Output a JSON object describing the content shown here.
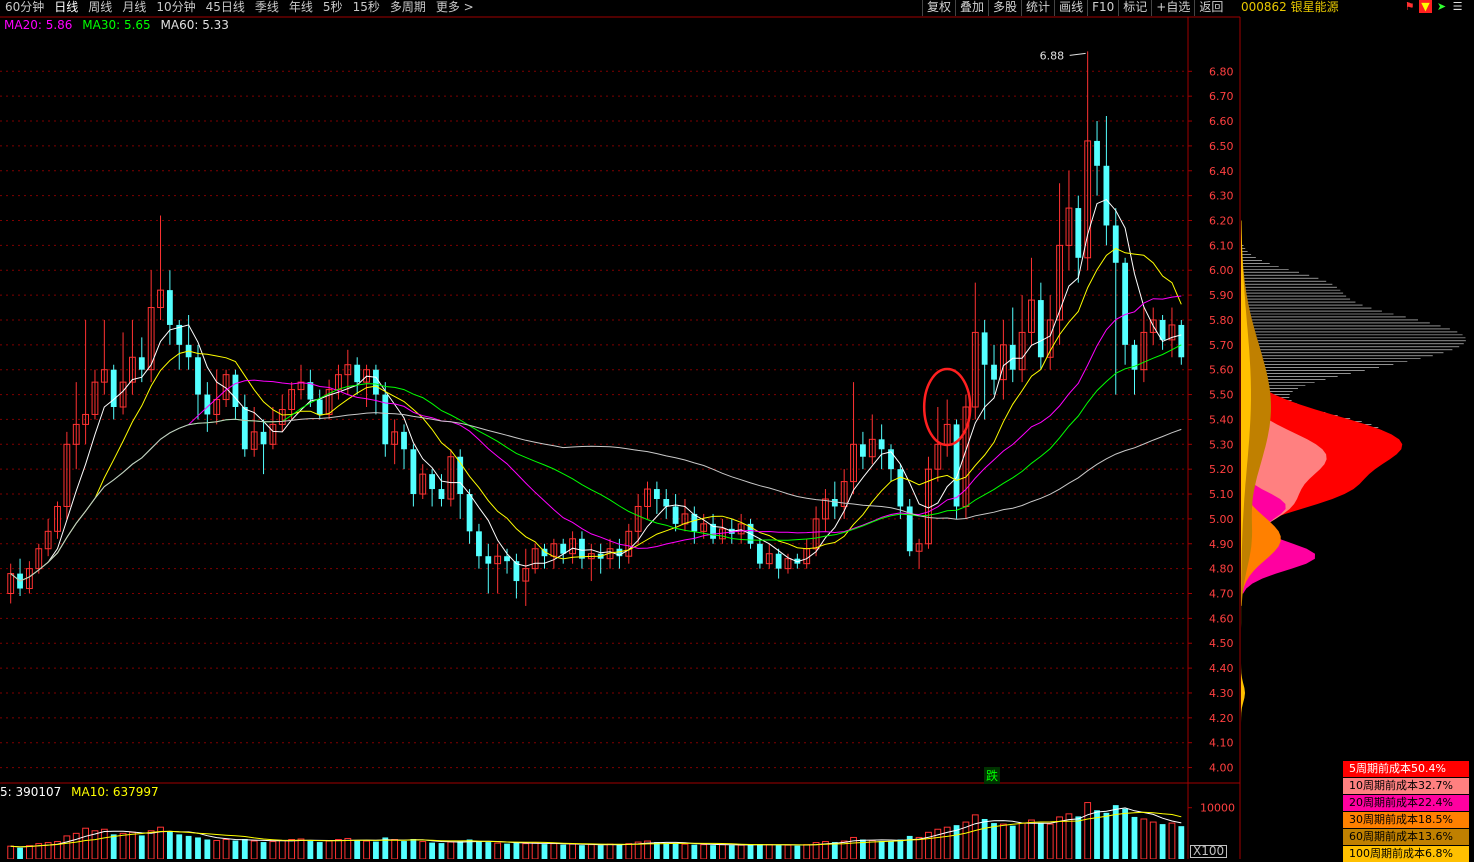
{
  "toolbar": {
    "periods": [
      "60分钟",
      "日线",
      "周线",
      "月线",
      "10分钟",
      "45日线",
      "季线",
      "年线",
      "5秒",
      "15秒",
      "多周期",
      "更多 >"
    ],
    "active_period": "日线",
    "buttons": [
      "复权",
      "叠加",
      "多股",
      "统计",
      "画线",
      "F10",
      "标记",
      "+自选",
      "返回"
    ]
  },
  "stock": {
    "code_name": "000862 银星能源"
  },
  "ma_legend": {
    "ma20": "MA20: 5.86",
    "ma30": "MA30: 5.65",
    "ma60": "MA60: 5.33"
  },
  "vol_legend": {
    "ma5": "5: 390107",
    "ma10": "MA10: 637997"
  },
  "annotations": {
    "high_label": "6.88",
    "die_badge": "跌",
    "vol_unit": "X100"
  },
  "colors": {
    "up": "#ff3232",
    "down": "#54ffff",
    "ma5": "#ffffff",
    "ma10": "#ffff00",
    "ma20": "#ff00ff",
    "ma30": "#00ff00",
    "ma60": "#c8c8c8",
    "grid": "#800000",
    "axis": "#a00000"
  },
  "price_axis": {
    "ticks": [
      "6.80",
      "6.70",
      "6.60",
      "6.50",
      "6.40",
      "6.30",
      "6.20",
      "6.10",
      "6.00",
      "5.90",
      "5.80",
      "5.70",
      "5.60",
      "5.50",
      "5.40",
      "5.30",
      "5.20",
      "5.10",
      "5.00",
      "4.90",
      "4.80",
      "4.70",
      "4.60",
      "4.50",
      "4.40",
      "4.30",
      "4.20",
      "4.10",
      "4.00"
    ]
  },
  "volume_axis": {
    "ticks": [
      "10000"
    ]
  },
  "cost_distribution": [
    {
      "label": "5周期前成本50.4%",
      "bg": "#ff0000",
      "fg": "#ffffff"
    },
    {
      "label": "10周期前成本32.7%",
      "bg": "#ff8080",
      "fg": "#000000"
    },
    {
      "label": "20周期前成本22.4%",
      "bg": "#ff00a0",
      "fg": "#000000"
    },
    {
      "label": "30周期前成本18.5%",
      "bg": "#ff8000",
      "fg": "#000000"
    },
    {
      "label": "60周期前成本13.6%",
      "bg": "#c08000",
      "fg": "#000000"
    },
    {
      "label": "100周期前成本6.8%",
      "bg": "#ffc000",
      "fg": "#000000"
    }
  ],
  "chart_data": {
    "type": "candlestick",
    "ylim": [
      4.0,
      6.88
    ],
    "candles": [
      [
        4.7,
        4.78,
        4.66,
        4.82
      ],
      [
        4.78,
        4.72,
        4.69,
        4.84
      ],
      [
        4.72,
        4.8,
        4.7,
        4.83
      ],
      [
        4.8,
        4.88,
        4.78,
        4.9
      ],
      [
        4.88,
        4.95,
        4.85,
        5.0
      ],
      [
        4.95,
        5.05,
        4.92,
        5.07
      ],
      [
        5.05,
        5.3,
        5.0,
        5.35
      ],
      [
        5.3,
        5.38,
        5.2,
        5.55
      ],
      [
        5.38,
        5.42,
        5.3,
        5.8
      ],
      [
        5.42,
        5.55,
        5.4,
        5.6
      ],
      [
        5.55,
        5.6,
        5.5,
        5.8
      ],
      [
        5.6,
        5.45,
        5.4,
        5.62
      ],
      [
        5.45,
        5.55,
        5.42,
        5.75
      ],
      [
        5.55,
        5.65,
        5.5,
        5.8
      ],
      [
        5.65,
        5.6,
        5.55,
        5.73
      ],
      [
        5.6,
        5.85,
        5.55,
        6.0
      ],
      [
        5.85,
        5.92,
        5.8,
        6.22
      ],
      [
        5.92,
        5.78,
        5.7,
        6.0
      ],
      [
        5.78,
        5.7,
        5.6,
        5.8
      ],
      [
        5.7,
        5.65,
        5.6,
        5.82
      ],
      [
        5.65,
        5.5,
        5.4,
        5.7
      ],
      [
        5.5,
        5.42,
        5.35,
        5.55
      ],
      [
        5.42,
        5.48,
        5.38,
        5.6
      ],
      [
        5.48,
        5.58,
        5.45,
        5.6
      ],
      [
        5.58,
        5.45,
        5.4,
        5.6
      ],
      [
        5.45,
        5.28,
        5.25,
        5.5
      ],
      [
        5.28,
        5.35,
        5.25,
        5.45
      ],
      [
        5.35,
        5.3,
        5.18,
        5.4
      ],
      [
        5.3,
        5.38,
        5.28,
        5.45
      ],
      [
        5.38,
        5.44,
        5.35,
        5.5
      ],
      [
        5.44,
        5.52,
        5.4,
        5.55
      ],
      [
        5.52,
        5.55,
        5.48,
        5.62
      ],
      [
        5.55,
        5.48,
        5.45,
        5.6
      ],
      [
        5.48,
        5.42,
        5.4,
        5.52
      ],
      [
        5.42,
        5.52,
        5.4,
        5.56
      ],
      [
        5.52,
        5.58,
        5.48,
        5.62
      ],
      [
        5.58,
        5.62,
        5.5,
        5.68
      ],
      [
        5.62,
        5.55,
        5.5,
        5.65
      ],
      [
        5.55,
        5.6,
        5.45,
        5.62
      ],
      [
        5.6,
        5.5,
        5.42,
        5.62
      ],
      [
        5.5,
        5.3,
        5.25,
        5.55
      ],
      [
        5.3,
        5.35,
        5.22,
        5.4
      ],
      [
        5.35,
        5.28,
        5.2,
        5.38
      ],
      [
        5.28,
        5.1,
        5.05,
        5.3
      ],
      [
        5.1,
        5.18,
        5.08,
        5.22
      ],
      [
        5.18,
        5.12,
        5.05,
        5.2
      ],
      [
        5.12,
        5.08,
        5.05,
        5.18
      ],
      [
        5.08,
        5.25,
        5.05,
        5.28
      ],
      [
        5.25,
        5.1,
        5.0,
        5.28
      ],
      [
        5.1,
        4.95,
        4.9,
        5.12
      ],
      [
        4.95,
        4.85,
        4.8,
        4.98
      ],
      [
        4.85,
        4.82,
        4.7,
        4.9
      ],
      [
        4.82,
        4.85,
        4.7,
        4.9
      ],
      [
        4.85,
        4.83,
        4.78,
        4.88
      ],
      [
        4.83,
        4.75,
        4.68,
        4.86
      ],
      [
        4.75,
        4.8,
        4.65,
        4.88
      ],
      [
        4.8,
        4.88,
        4.78,
        4.9
      ],
      [
        4.88,
        4.85,
        4.8,
        4.9
      ],
      [
        4.85,
        4.9,
        4.8,
        4.92
      ],
      [
        4.9,
        4.86,
        4.82,
        4.92
      ],
      [
        4.86,
        4.92,
        4.82,
        4.95
      ],
      [
        4.92,
        4.84,
        4.8,
        4.95
      ],
      [
        4.84,
        4.86,
        4.75,
        4.9
      ],
      [
        4.86,
        4.84,
        4.78,
        4.9
      ],
      [
        4.84,
        4.88,
        4.8,
        4.92
      ],
      [
        4.88,
        4.85,
        4.8,
        4.92
      ],
      [
        4.85,
        4.95,
        4.82,
        4.98
      ],
      [
        4.95,
        5.05,
        4.9,
        5.1
      ],
      [
        5.05,
        5.12,
        5.0,
        5.15
      ],
      [
        5.12,
        5.08,
        5.02,
        5.15
      ],
      [
        5.08,
        5.05,
        5.0,
        5.12
      ],
      [
        5.05,
        4.98,
        4.95,
        5.1
      ],
      [
        4.98,
        5.02,
        4.95,
        5.08
      ],
      [
        5.02,
        4.95,
        4.9,
        5.05
      ],
      [
        4.95,
        4.98,
        4.92,
        5.02
      ],
      [
        4.98,
        4.92,
        4.9,
        5.02
      ],
      [
        4.92,
        4.96,
        4.9,
        5.0
      ],
      [
        4.96,
        4.94,
        4.9,
        5.0
      ],
      [
        4.94,
        4.98,
        4.9,
        5.02
      ],
      [
        4.98,
        4.9,
        4.88,
        5.0
      ],
      [
        4.9,
        4.82,
        4.8,
        4.92
      ],
      [
        4.82,
        4.86,
        4.8,
        4.9
      ],
      [
        4.86,
        4.8,
        4.76,
        4.88
      ],
      [
        4.8,
        4.84,
        4.78,
        4.86
      ],
      [
        4.84,
        4.82,
        4.8,
        4.86
      ],
      [
        4.82,
        4.88,
        4.8,
        4.92
      ],
      [
        4.88,
        5.0,
        4.85,
        5.05
      ],
      [
        5.0,
        5.08,
        4.95,
        5.12
      ],
      [
        5.08,
        5.05,
        5.0,
        5.15
      ],
      [
        5.05,
        5.15,
        5.0,
        5.2
      ],
      [
        5.15,
        5.3,
        5.1,
        5.55
      ],
      [
        5.3,
        5.25,
        5.2,
        5.35
      ],
      [
        5.25,
        5.32,
        5.22,
        5.42
      ],
      [
        5.32,
        5.28,
        5.2,
        5.38
      ],
      [
        5.28,
        5.2,
        5.15,
        5.3
      ],
      [
        5.2,
        5.05,
        5.0,
        5.22
      ],
      [
        5.05,
        4.87,
        4.85,
        5.08
      ],
      [
        4.87,
        4.9,
        4.8,
        4.92
      ],
      [
        4.9,
        5.2,
        4.88,
        5.25
      ],
      [
        5.2,
        5.3,
        5.15,
        5.45
      ],
      [
        5.3,
        5.38,
        5.25,
        5.48
      ],
      [
        5.38,
        5.05,
        5.0,
        5.4
      ],
      [
        5.05,
        5.45,
        5.0,
        5.5
      ],
      [
        5.45,
        5.75,
        5.4,
        5.95
      ],
      [
        5.75,
        5.62,
        5.4,
        5.8
      ],
      [
        5.62,
        5.56,
        5.5,
        5.7
      ],
      [
        5.56,
        5.7,
        5.48,
        5.8
      ],
      [
        5.7,
        5.6,
        5.55,
        5.85
      ],
      [
        5.6,
        5.75,
        5.55,
        5.9
      ],
      [
        5.75,
        5.88,
        5.7,
        6.05
      ],
      [
        5.88,
        5.65,
        5.6,
        5.95
      ],
      [
        5.65,
        5.8,
        5.6,
        5.9
      ],
      [
        5.8,
        6.1,
        5.7,
        6.35
      ],
      [
        6.1,
        6.25,
        6.0,
        6.4
      ],
      [
        6.25,
        6.05,
        5.95,
        6.3
      ],
      [
        6.05,
        6.52,
        6.0,
        6.88
      ],
      [
        6.52,
        6.42,
        6.3,
        6.6
      ],
      [
        6.42,
        6.18,
        6.1,
        6.62
      ],
      [
        6.18,
        6.03,
        5.5,
        6.25
      ],
      [
        6.03,
        5.7,
        5.62,
        6.05
      ],
      [
        5.7,
        5.6,
        5.5,
        5.72
      ],
      [
        5.6,
        5.75,
        5.55,
        5.85
      ],
      [
        5.75,
        5.8,
        5.7,
        5.85
      ],
      [
        5.8,
        5.72,
        5.68,
        5.82
      ],
      [
        5.72,
        5.78,
        5.65,
        5.85
      ],
      [
        5.78,
        5.65,
        5.62,
        5.8
      ]
    ],
    "volumes": [
      2500,
      2200,
      2600,
      3000,
      3200,
      3400,
      4500,
      5000,
      6000,
      5500,
      5800,
      4800,
      5000,
      5200,
      4600,
      5500,
      6200,
      5400,
      4800,
      4500,
      4200,
      3800,
      3600,
      3800,
      3600,
      3900,
      3500,
      3300,
      3400,
      3600,
      3800,
      3900,
      3500,
      3300,
      3500,
      3800,
      4000,
      3600,
      3500,
      3400,
      4200,
      3800,
      3500,
      3900,
      3400,
      3200,
      3100,
      3300,
      3500,
      3800,
      3400,
      3300,
      3100,
      3000,
      3200,
      3000,
      3100,
      2900,
      3000,
      2800,
      2900,
      2700,
      2800,
      2700,
      2900,
      2800,
      3000,
      3300,
      3500,
      3300,
      3100,
      3000,
      2900,
      2800,
      2800,
      2700,
      2800,
      2700,
      2700,
      2800,
      2900,
      2800,
      2700,
      2700,
      2600,
      2800,
      3200,
      3400,
      3300,
      3500,
      4200,
      3800,
      3600,
      3500,
      3400,
      3800,
      4500,
      4200,
      5200,
      5800,
      6200,
      6600,
      7200,
      8600,
      7800,
      7000,
      6800,
      6500,
      7000,
      7600,
      7000,
      6800,
      8200,
      8800,
      8300,
      11000,
      9500,
      9000,
      10500,
      9800,
      8200,
      7800,
      7200,
      6800,
      7000,
      6400
    ]
  }
}
